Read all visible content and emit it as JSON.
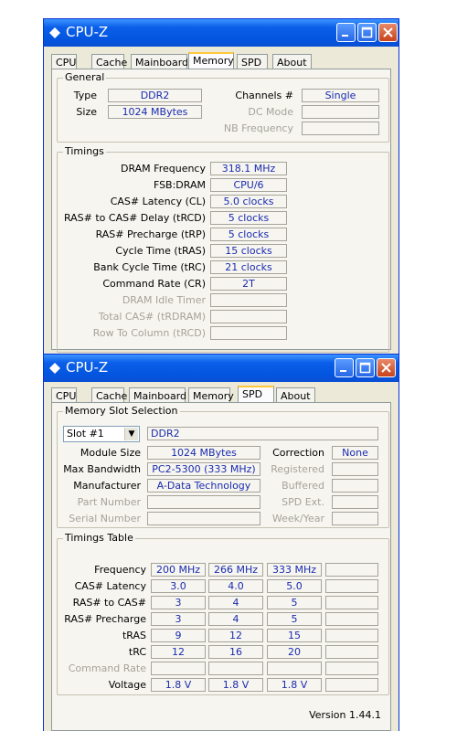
{
  "window1": {
    "title": "CPU-Z",
    "tabs": [
      "CPU",
      "Cache",
      "Mainboard",
      "Memory",
      "SPD",
      "About"
    ],
    "active_tab": "Memory",
    "general": {
      "title": "General",
      "type_label": "Type",
      "type_value": "DDR2",
      "size_label": "Size",
      "size_value": "1024 MBytes",
      "channels_label": "Channels #",
      "channels_value": "Single",
      "dc_mode_label": "DC Mode",
      "dc_mode_value": "",
      "nb_freq_label": "NB Frequency",
      "nb_freq_value": ""
    },
    "timings": {
      "title": "Timings",
      "rows": [
        {
          "label": "DRAM Frequency",
          "value": "318.1 MHz"
        },
        {
          "label": "FSB:DRAM",
          "value": "CPU/6"
        },
        {
          "label": "CAS# Latency (CL)",
          "value": "5.0 clocks"
        },
        {
          "label": "RAS# to CAS# Delay (tRCD)",
          "value": "5 clocks"
        },
        {
          "label": "RAS# Precharge (tRP)",
          "value": "5 clocks"
        },
        {
          "label": "Cycle Time (tRAS)",
          "value": "15 clocks"
        },
        {
          "label": "Bank Cycle Time (tRC)",
          "value": "21 clocks"
        },
        {
          "label": "Command Rate (CR)",
          "value": "2T"
        },
        {
          "label": "DRAM Idle Timer",
          "value": ""
        },
        {
          "label": "Total CAS# (tRDRAM)",
          "value": ""
        },
        {
          "label": "Row To Column (tRCD)",
          "value": ""
        }
      ]
    }
  },
  "window2": {
    "title": "CPU-Z",
    "tabs": [
      "CPU",
      "Cache",
      "Mainboard",
      "Memory",
      "SPD",
      "About"
    ],
    "active_tab": "SPD",
    "slot_section": {
      "title": "Memory Slot Selection",
      "slot_selected": "Slot #1",
      "slot_type": "DDR2",
      "module_size_label": "Module Size",
      "module_size_value": "1024 MBytes",
      "max_bw_label": "Max Bandwidth",
      "max_bw_value": "PC2-5300 (333 MHz)",
      "manufacturer_label": "Manufacturer",
      "manufacturer_value": "A-Data Technology",
      "part_label": "Part Number",
      "part_value": "",
      "serial_label": "Serial Number",
      "serial_value": "",
      "correction_label": "Correction",
      "correction_value": "None",
      "registered_label": "Registered",
      "registered_value": "",
      "buffered_label": "Buffered",
      "buffered_value": "",
      "spd_ext_label": "SPD Ext.",
      "spd_ext_value": "",
      "week_year_label": "Week/Year",
      "week_year_value": ""
    },
    "timings_table": {
      "title": "Timings Table",
      "rows": [
        {
          "label": "Frequency",
          "values": [
            "200 MHz",
            "266 MHz",
            "333 MHz",
            ""
          ]
        },
        {
          "label": "CAS# Latency",
          "values": [
            "3.0",
            "4.0",
            "5.0",
            ""
          ]
        },
        {
          "label": "RAS# to CAS#",
          "values": [
            "3",
            "4",
            "5",
            ""
          ]
        },
        {
          "label": "RAS# Precharge",
          "values": [
            "3",
            "4",
            "5",
            ""
          ]
        },
        {
          "label": "tRAS",
          "values": [
            "9",
            "12",
            "15",
            ""
          ]
        },
        {
          "label": "tRC",
          "values": [
            "12",
            "16",
            "20",
            ""
          ]
        },
        {
          "label": "Command Rate",
          "values": [
            "",
            "",
            "",
            ""
          ]
        },
        {
          "label": "Voltage",
          "values": [
            "1.8 V",
            "1.8 V",
            "1.8 V",
            ""
          ]
        }
      ]
    },
    "version": "Version 1.44.1"
  }
}
